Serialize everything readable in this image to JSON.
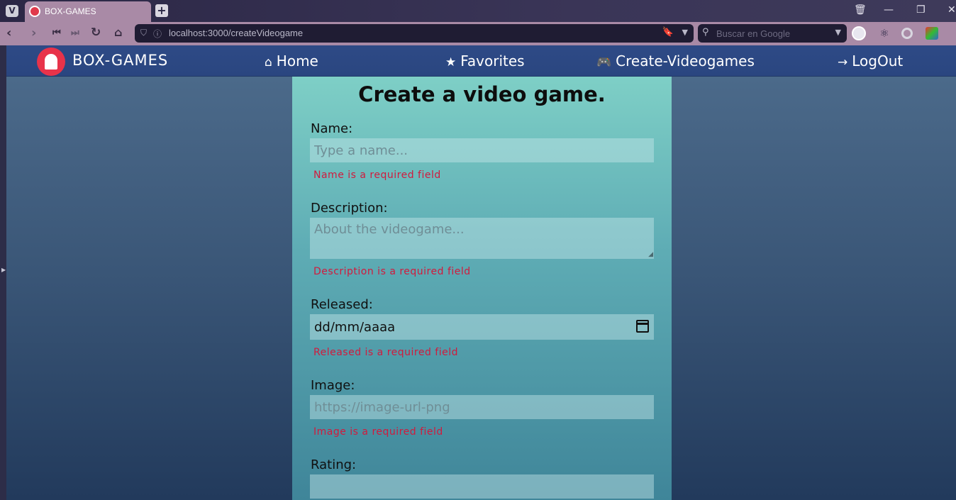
{
  "browser": {
    "tab_title": "BOX-GAMES",
    "url": "localhost:3000/createVideogame",
    "search_placeholder": "Buscar en Google"
  },
  "app": {
    "brand": "BOX-GAMES",
    "nav": {
      "home": "Home",
      "favorites": "Favorites",
      "create": "Create-Videogames",
      "logout": "LogOut"
    }
  },
  "form": {
    "title": "Create a video game.",
    "name": {
      "label": "Name:",
      "placeholder": "Type a name...",
      "error": "Name is a required field"
    },
    "description": {
      "label": "Description:",
      "placeholder": "About the videogame...",
      "error": "Description is a required field"
    },
    "released": {
      "label": "Released:",
      "value": "dd/mm/aaaa",
      "error": "Released is a required field"
    },
    "image": {
      "label": "Image:",
      "placeholder": "https://image-url-png",
      "error": "Image is a required field"
    },
    "rating": {
      "label": "Rating:"
    }
  },
  "colors": {
    "accent": "#e8334a",
    "error": "#d11a3d",
    "nav_bg": "#2e4a86"
  }
}
